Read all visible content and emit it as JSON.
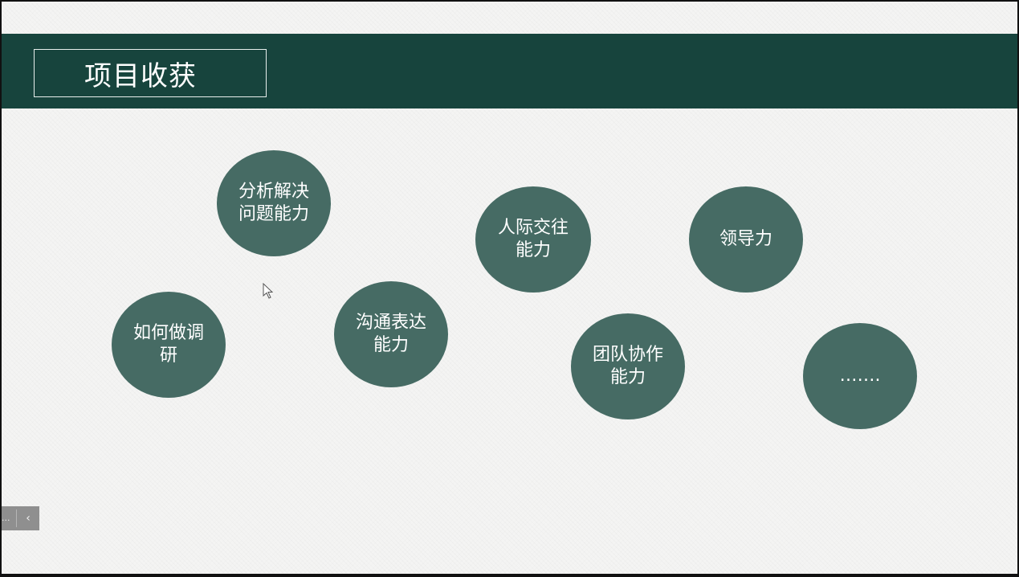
{
  "slide": {
    "title": "项目收获",
    "header_color": "#17443d",
    "bubble_color": "#466b64",
    "bubbles": [
      {
        "label": "分析解决\n问题能力"
      },
      {
        "label": "如何做调\n研"
      },
      {
        "label": "沟通表达\n能力"
      },
      {
        "label": "人际交往\n能力"
      },
      {
        "label": "领导力"
      },
      {
        "label": "团队协作\n能力"
      },
      {
        "label": "……."
      }
    ]
  },
  "cursor": {
    "icon": "mouse-pointer-icon"
  },
  "nav": {
    "more_label": "...",
    "prev_icon": "chevron-left-icon",
    "prev_label": "‹"
  }
}
